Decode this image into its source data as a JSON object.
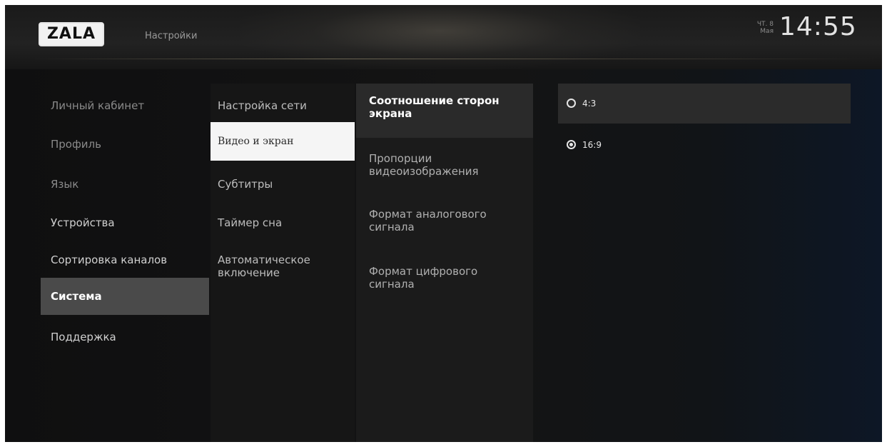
{
  "header": {
    "logo": "ZALA",
    "title": "Настройки",
    "date_line1": "ЧТ. 8",
    "date_line2": "Мая",
    "time": "14:55"
  },
  "menu_main": {
    "items": [
      {
        "label": "Личный кабинет"
      },
      {
        "label": "Профиль"
      },
      {
        "label": "Язык"
      },
      {
        "label": "Устройства"
      },
      {
        "label": "Сортировка каналов"
      },
      {
        "label": "Система",
        "selected": true
      },
      {
        "label": "Поддержка"
      }
    ]
  },
  "menu_system": {
    "items": [
      {
        "label": "Настройка сети"
      },
      {
        "label": "Видео и экран",
        "focused": true
      },
      {
        "label": "Субтитры"
      },
      {
        "label": "Таймер сна"
      },
      {
        "label": "Автоматическое включение"
      }
    ]
  },
  "menu_video": {
    "items": [
      {
        "label": "Соотношение сторон экрана",
        "active": true
      },
      {
        "label": "Пропорции видеоизображения"
      },
      {
        "label": "Формат аналогового сигнала"
      },
      {
        "label": "Формат цифрового сигнала"
      }
    ]
  },
  "aspect_options": {
    "items": [
      {
        "label": "4:3",
        "checked": false
      },
      {
        "label": "16:9",
        "checked": true
      }
    ]
  },
  "colors": {
    "background": "#141414",
    "selected_bg": "#4a4a4a",
    "focused_bg": "#f5f5f5",
    "text": "#c9c9c9"
  }
}
